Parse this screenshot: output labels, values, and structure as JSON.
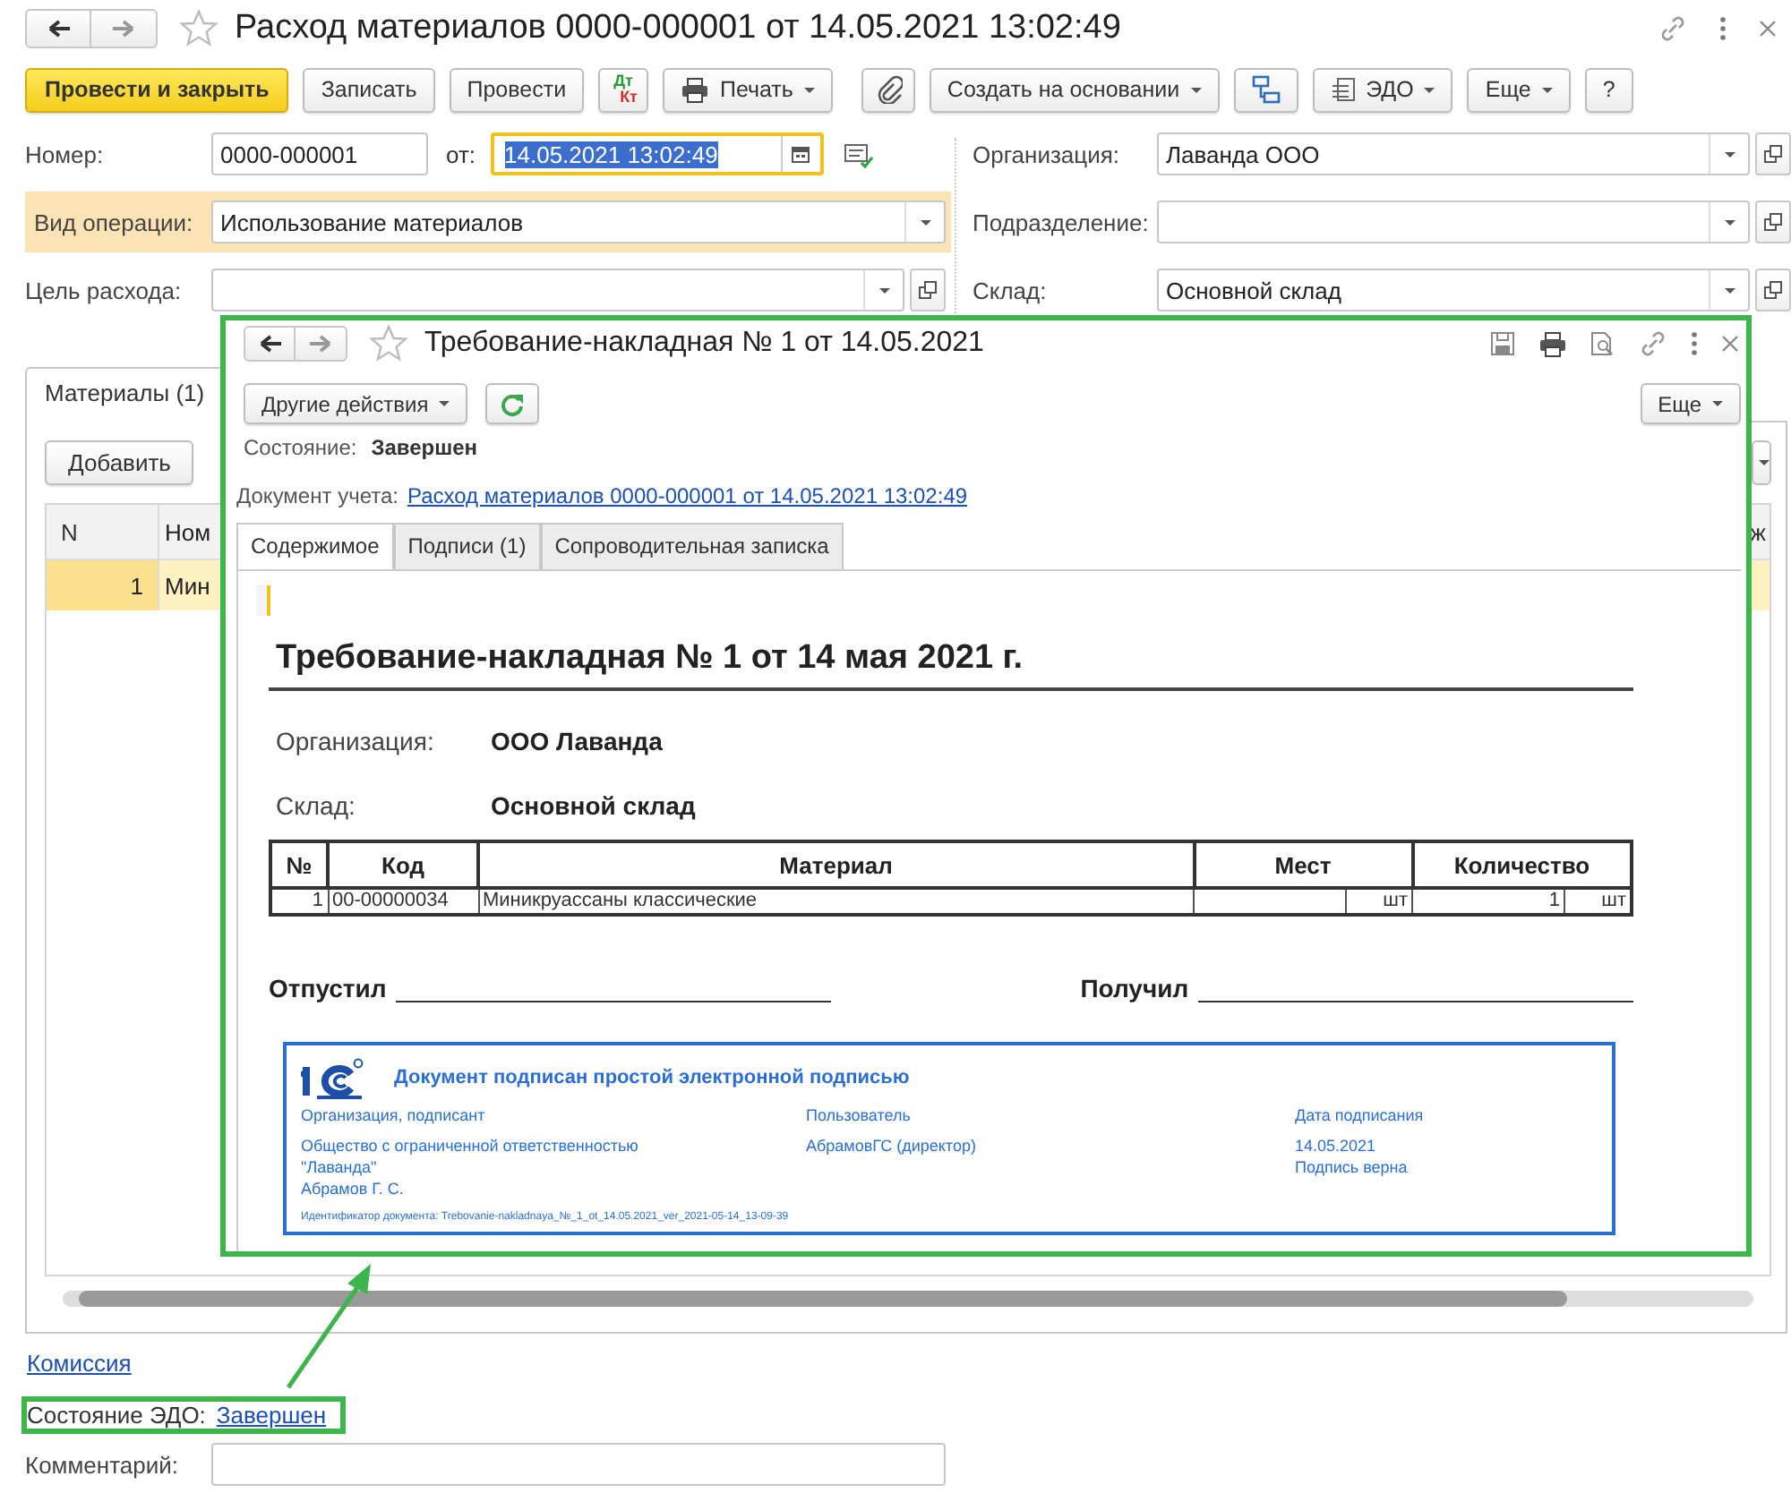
{
  "window": {
    "title": "Расход материалов 0000-000001 от 14.05.2021 13:02:49"
  },
  "toolbar": [
    {
      "kind": "primary",
      "label": "Провести и закрыть"
    },
    {
      "kind": "plain",
      "label": "Записать"
    },
    {
      "kind": "plain",
      "label": "Провести"
    },
    {
      "kind": "dtkt",
      "label": "Дт",
      "label2": "Кт"
    },
    {
      "kind": "print",
      "label": "Печать"
    },
    {
      "kind": "clip"
    },
    {
      "kind": "menu",
      "label": "Создать на основании"
    },
    {
      "kind": "struct"
    },
    {
      "kind": "edo",
      "label": "ЭДО"
    },
    {
      "kind": "menu",
      "label": "Еще"
    },
    {
      "kind": "plain",
      "label": "?"
    }
  ],
  "header_fields": {
    "number": {
      "label": "Номер:",
      "value": "0000-000001"
    },
    "date": {
      "label": "от:",
      "value": "14.05.2021 13:02:49",
      "focused": true
    },
    "operation": {
      "label": "Вид операции:",
      "value": "Использование материалов",
      "highlighted": true
    },
    "purpose": {
      "label": "Цель расхода:"
    },
    "organization": {
      "label": "Организация:",
      "value": "Лаванда ООО"
    },
    "department": {
      "label": "Подразделение:"
    },
    "warehouse": {
      "label": "Склад:",
      "value": "Основной склад"
    }
  },
  "tabs": [
    {
      "label": "Материалы (1)",
      "selected": true
    }
  ],
  "materials": {
    "add_button": "Добавить",
    "columns": [
      "N",
      "Ном",
      "ж"
    ],
    "rows": [
      {
        "n": "1",
        "name": "Мин",
        "selected": true
      }
    ]
  },
  "commission_link": "Комиссия",
  "edo_state": {
    "label": "Состояние ЭДО:",
    "value": "Завершен"
  },
  "comment": {
    "label": "Комментарий:"
  },
  "popup": {
    "title": "Требование-накладная № 1 от 14.05.2021",
    "actions_button": "Другие действия",
    "more_button": "Еще",
    "state": {
      "label": "Состояние:",
      "value": "Завершен"
    },
    "document": {
      "label": "Документ учета:",
      "link": "Расход материалов 0000-000001 от 14.05.2021 13:02:49"
    },
    "tabs": [
      {
        "label": "Содержимое",
        "selected": true
      },
      {
        "label": "Подписи (1)",
        "selected": false
      },
      {
        "label": "Сопроводительная записка",
        "selected": false
      }
    ],
    "printout": {
      "title": "Требование-накладная № 1 от 14 мая 2021 г.",
      "fields": [
        {
          "label": "Организация:",
          "value": "ООО Лаванда"
        },
        {
          "label": "Склад:",
          "value": "Основной склад"
        }
      ],
      "columns": [
        "№",
        "Код",
        "Материал",
        "Мест",
        "Количество"
      ],
      "rows": [
        {
          "n": "1",
          "code": "00-00000034",
          "material": "Миникруассаны классические",
          "places": "",
          "places_unit": "шт",
          "qty": "1",
          "qty_unit": "шт"
        }
      ],
      "released_label": "Отпустил",
      "received_label": "Получил",
      "stamp": {
        "title": "Документ подписан простой электронной подписью",
        "columns": [
          {
            "header": "Организация, подписант",
            "lines": [
              "Общество с ограниченной ответственностью",
              "\"Лаванда\"",
              "Абрамов Г. С."
            ]
          },
          {
            "header": "Пользователь",
            "lines": [
              "АбрамовГС (директор)"
            ]
          },
          {
            "header": "Дата подписания",
            "lines": [
              "14.05.2021",
              "Подпись верна"
            ]
          }
        ],
        "doc_id": "Идентификатор документа: Trebovanie-nakladnaya_№_1_ot_14.05.2021_ver_2021-05-14_13-09-39"
      }
    }
  }
}
